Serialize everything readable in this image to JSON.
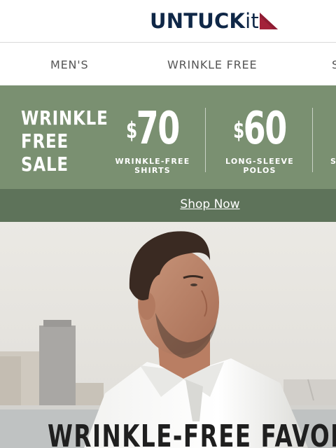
{
  "brand": {
    "logo_main": "UNTUCK",
    "logo_suffix": "it",
    "colors": {
      "navy": "#0f2747",
      "red": "#a3223a"
    }
  },
  "nav": {
    "items": [
      "MEN'S",
      "WRINKLE FREE",
      "S"
    ]
  },
  "promo": {
    "title_lines": [
      "WRINKLE",
      "FREE",
      "SALE"
    ],
    "deals": [
      {
        "currency": "$",
        "price": "70",
        "caption_lines": [
          "WRINKLE-FREE",
          "SHIRTS"
        ]
      },
      {
        "currency": "$",
        "price": "60",
        "caption_lines": [
          "LONG-SLEEVE",
          "POLOS"
        ]
      },
      {
        "caption_lines": [
          "S",
          ""
        ]
      }
    ],
    "bg_color": "#7a9071",
    "bar_color": "#5e735a",
    "cta": "Shop Now"
  },
  "hero": {
    "heading": "WRINKLE-FREE FAVORITES",
    "image": "man-in-white-polo-waterfront-skyline"
  }
}
